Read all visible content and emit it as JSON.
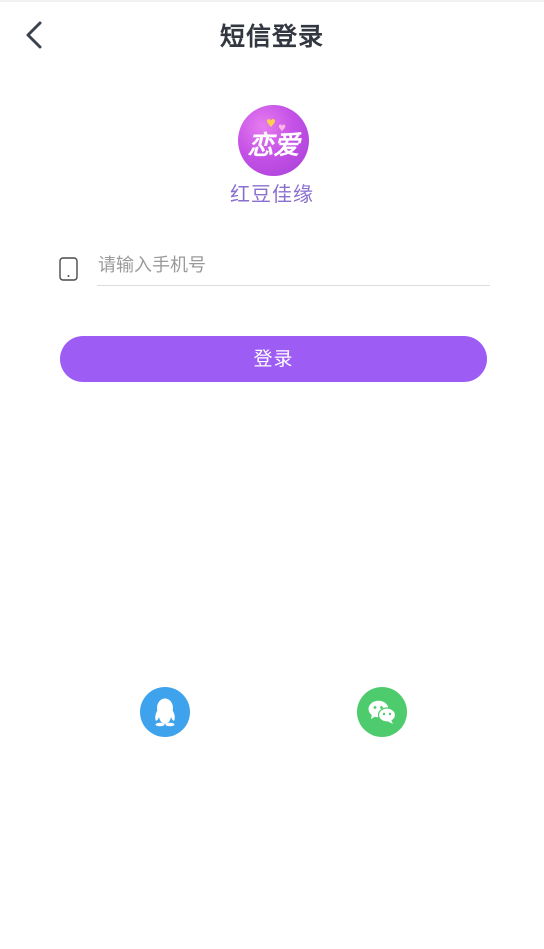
{
  "header": {
    "title": "短信登录"
  },
  "logo": {
    "text": "恋爱"
  },
  "app": {
    "name": "红豆佳缘"
  },
  "form": {
    "phone_placeholder": "请输入手机号",
    "phone_value": ""
  },
  "actions": {
    "login_label": "登录"
  },
  "social": {
    "qq": {
      "icon": "qq-icon",
      "color": "#3ea2ec"
    },
    "wechat": {
      "icon": "wechat-icon",
      "color": "#4ecb6c"
    }
  },
  "colors": {
    "accent": "#9d5cf4",
    "app_name": "#8a6fcf",
    "title": "#333840"
  }
}
